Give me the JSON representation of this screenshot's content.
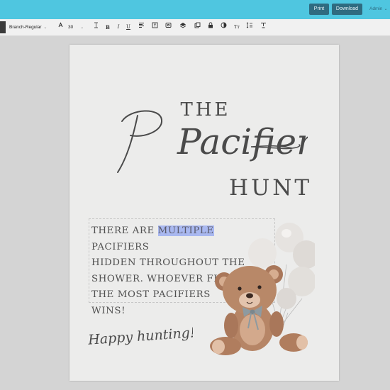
{
  "topbar": {
    "print_label": "Print",
    "download_label": "Download",
    "admin_label": "Admin"
  },
  "toolbar": {
    "font_name": "Branch-Regular",
    "font_size": "30",
    "bold": "B",
    "italic": "I",
    "underline": "U",
    "text_style": "Tт"
  },
  "page": {
    "title_the": "THE",
    "title_script": "Pacifier",
    "title_hunt": "HUNT",
    "body_lines": {
      "line1_before": "THERE ARE ",
      "line1_highlight": "MULTIPLE",
      "line1_after": " PACIFIERS",
      "line2": "HIDDEN THROUGHOUT THE",
      "line3": "SHOWER. WHOEVER FINDS",
      "line4": "THE MOST PACIFIERS",
      "line5": "WINS!"
    },
    "signoff": "Happy hunting!"
  },
  "colors": {
    "topbar": "#4fc6e0",
    "button": "#2f6b80",
    "page": "#ececeb",
    "text": "#4a4a4a",
    "highlight": "#a9b8f0"
  }
}
